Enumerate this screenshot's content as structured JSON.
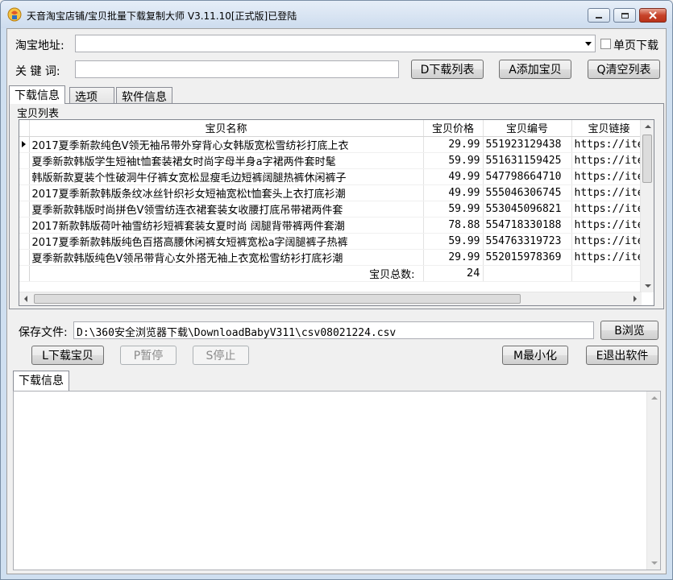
{
  "window": {
    "title": "天音淘宝店铺/宝贝批量下载复制大师 V3.11.10[正式版]已登陆"
  },
  "form": {
    "url_label": "淘宝地址:",
    "url_value": "",
    "single_page_label": "单页下载",
    "single_page_checked": false,
    "keyword_label": "关 键 词:",
    "keyword_value": "",
    "download_list_button": "D下载列表",
    "add_item_button": "A添加宝贝",
    "clear_list_button": "Q清空列表"
  },
  "tabs": [
    {
      "label": "下载信息",
      "active": true
    },
    {
      "label": "选项",
      "active": false
    },
    {
      "label": "软件信息",
      "active": false
    }
  ],
  "item_list": {
    "group_label": "宝贝列表",
    "columns": [
      "宝贝名称",
      "宝贝价格",
      "宝贝编号",
      "宝贝链接"
    ],
    "rows": [
      {
        "name": "2017夏季新款纯色V领无袖吊带外穿背心女韩版宽松雪纺衫打底上衣",
        "price": "29.99",
        "id": "551923129438",
        "link": "https://ite"
      },
      {
        "name": "夏季新款韩版学生短袖t恤套装裙女时尚字母半身a字裙两件套时髦",
        "price": "59.99",
        "id": "551631159425",
        "link": "https://ite"
      },
      {
        "name": "韩版新款夏装个性破洞牛仔裤女宽松显瘦毛边短裤阔腿热裤休闲裤子",
        "price": "49.99",
        "id": "547798664710",
        "link": "https://ite"
      },
      {
        "name": "2017夏季新款韩版条纹冰丝针织衫女短袖宽松t恤套头上衣打底衫潮",
        "price": "49.99",
        "id": "555046306745",
        "link": "https://ite"
      },
      {
        "name": "夏季新款韩版时尚拼色V领雪纺连衣裙套装女收腰打底吊带裙两件套",
        "price": "59.99",
        "id": "553045096821",
        "link": "https://ite"
      },
      {
        "name": "2017新款韩版荷叶袖雪纺衫短裤套装女夏时尚 阔腿背带裤两件套潮",
        "price": "78.88",
        "id": "554718330188",
        "link": "https://ite"
      },
      {
        "name": "2017夏季新款韩版纯色百搭高腰休闲裤女短裤宽松a字阔腿裤子热裤",
        "price": "59.99",
        "id": "554763319723",
        "link": "https://ite"
      },
      {
        "name": "夏季新款韩版纯色V领吊带背心女外搭无袖上衣宽松雪纺衫打底衫潮",
        "price": "29.99",
        "id": "552015978369",
        "link": "https://ite"
      }
    ],
    "total_label": "宝贝总数:",
    "total_value": "24"
  },
  "save": {
    "label": "保存文件:",
    "path": "D:\\360安全浏览器下载\\DownloadBabyV311\\csv08021224.csv",
    "browse_button": "B浏览"
  },
  "actions": {
    "download_button": "L下载宝贝",
    "pause_button": "P暂停",
    "stop_button": "S停止",
    "minimize_button": "M最小化",
    "exit_button": "E退出软件"
  },
  "log": {
    "tab_label": "下载信息",
    "content": ""
  },
  "colors": {
    "title_bar": "#cddcee",
    "close_button": "#c7432a"
  }
}
